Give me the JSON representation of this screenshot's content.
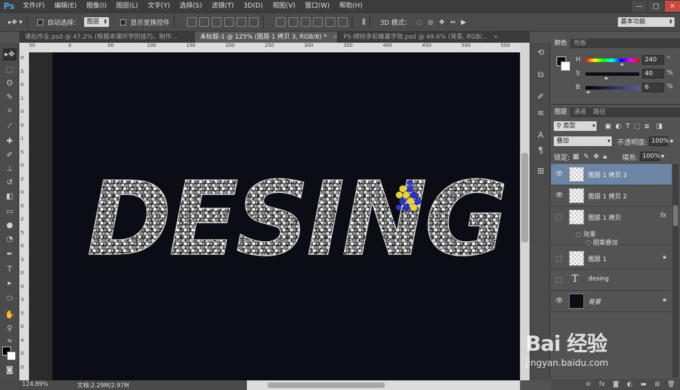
{
  "app": {
    "logo": "Ps"
  },
  "menu": [
    "文件(F)",
    "编辑(E)",
    "图像(I)",
    "图层(L)",
    "文字(Y)",
    "选择(S)",
    "滤镜(T)",
    "3D(D)",
    "视图(V)",
    "窗口(W)",
    "帮助(H)"
  ],
  "window_controls": {
    "minimize": "—",
    "maximize": "□",
    "close": "✕"
  },
  "options": {
    "auto_select_label": "自动选择：",
    "auto_select_value": "图层",
    "show_transform_label": "显示变换控件",
    "mode_3d_label": "3D 模式：",
    "workspace": "基本功能"
  },
  "tabs": [
    {
      "label": "课后作业.psd @ 47.2% (根据本课所学的技巧，制作...",
      "active": false
    },
    {
      "label": "未标题-1 @ 125% (图层 1 拷贝 3, RGB/8) *",
      "active": true
    },
    {
      "label": "PS-缤纷多彩蜂巢字效.psd @ 49.6% (背景, RGB/...",
      "active": false
    }
  ],
  "rulers": {
    "top": [
      "50",
      "0",
      "50",
      "100",
      "150",
      "200",
      "250",
      "300",
      "350",
      "400",
      "450",
      "500",
      "550"
    ],
    "left": [
      "0",
      "5",
      "0",
      "1",
      "0",
      "0",
      "1",
      "5",
      "0",
      "2",
      "0",
      "0",
      "2",
      "5",
      "0",
      "3",
      "0",
      "0",
      "3",
      "5",
      "0",
      "4",
      "0",
      "0"
    ]
  },
  "canvas": {
    "text": "DESING"
  },
  "status": {
    "zoom": "124.89%",
    "doc": "文档:2.29M/2.97M"
  },
  "color_panel": {
    "tabs": [
      "颜色",
      "色板"
    ],
    "h": {
      "label": "H",
      "value": "240",
      "unit": "°"
    },
    "s": {
      "label": "S",
      "value": "40",
      "unit": "%"
    },
    "b": {
      "label": "B",
      "value": "6",
      "unit": "%"
    }
  },
  "layers_panel": {
    "tabs": [
      "图层",
      "通道",
      "路径"
    ],
    "filter": "类型",
    "blend_mode": "叠加",
    "opacity_label": "不透明度:",
    "opacity_value": "100%",
    "lock_label": "锁定:",
    "fill_label": "填充:",
    "fill_value": "100%",
    "layers": [
      {
        "name": "图层 1 拷贝 3",
        "visible": true,
        "selected": true
      },
      {
        "name": "图层 1 拷贝 2",
        "visible": true,
        "selected": false
      },
      {
        "name": "图层 1 拷贝",
        "visible": false,
        "selected": false,
        "fx": "fx"
      },
      {
        "name": "图层 1",
        "visible": false,
        "selected": false
      },
      {
        "name": "desing",
        "visible": false,
        "selected": false,
        "type": "text"
      },
      {
        "name": "背景",
        "visible": true,
        "selected": false,
        "type": "background"
      }
    ],
    "effects_label": "效果",
    "pattern_overlay_label": "图案叠加"
  },
  "watermark": {
    "brand": "Bai 经验",
    "url": "jingyan.baidu.com"
  },
  "colors": {
    "accent_selection": "#6e86a6",
    "canvas_bg": "#0b0c14"
  }
}
